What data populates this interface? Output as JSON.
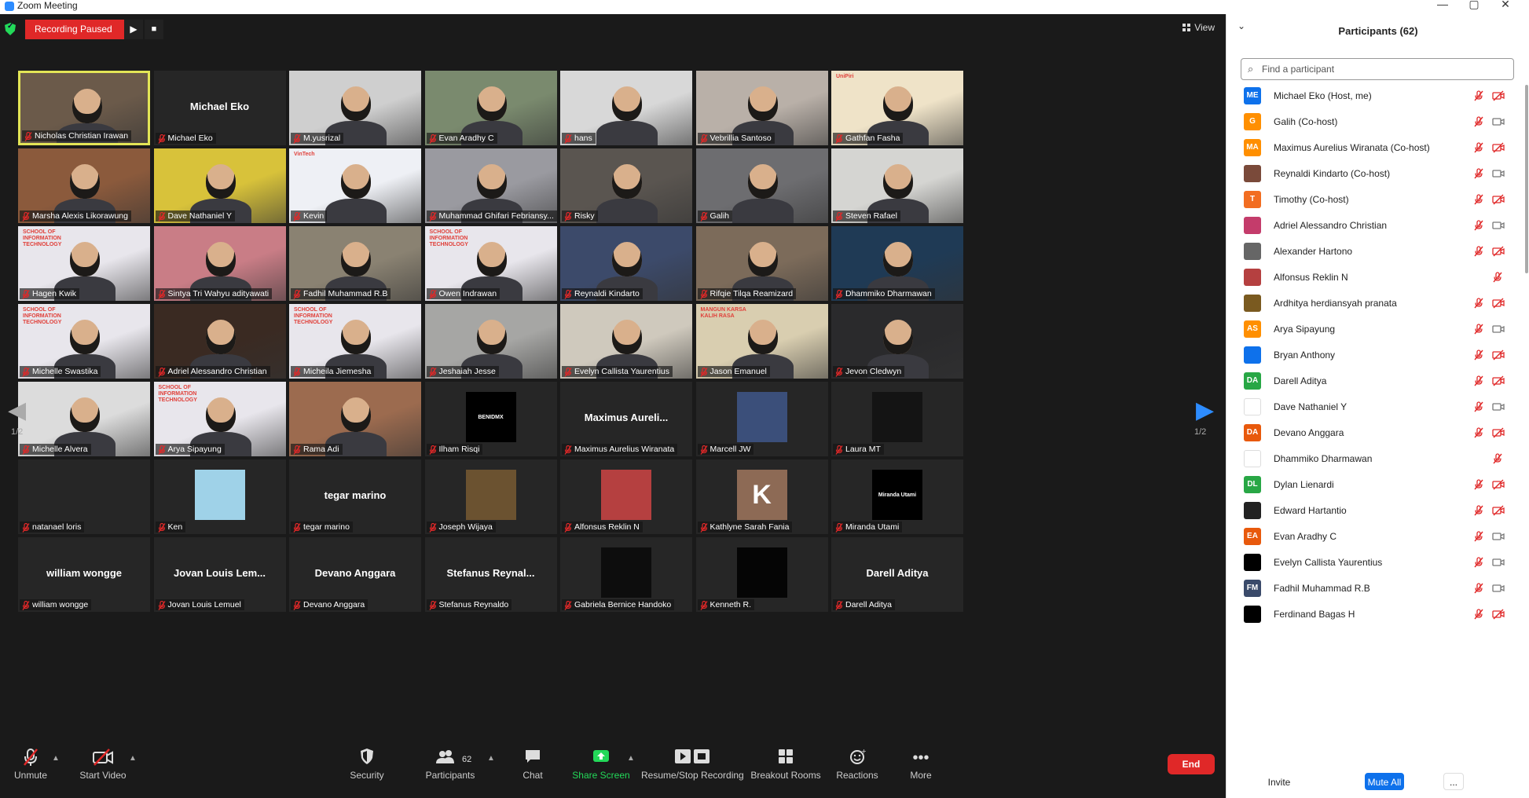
{
  "window": {
    "title": "Zoom Meeting",
    "controls": [
      "—",
      "▢",
      "✕"
    ]
  },
  "topbar": {
    "recording_status": "Recording Paused",
    "play_glyph": "▶",
    "stop_glyph": "■",
    "view_label": "View"
  },
  "colors": {
    "record_red": "#e02828",
    "accent_blue": "#2d8cff",
    "share_green": "#23d959",
    "mute_red": "#e02828",
    "speaker_yellow": "#e3e556"
  },
  "grid": {
    "page_indicator": "1/2",
    "prev_glyph": "◀",
    "next_glyph": "▶",
    "tiles": [
      {
        "label": "Nicholas Christian Irawan",
        "active": true,
        "kind": "video",
        "bg": "#6b5a4a"
      },
      {
        "label": "Michael Eko",
        "kind": "name",
        "big_text": "Michael Eko"
      },
      {
        "label": "M.yusrizal",
        "kind": "video",
        "bg": "#cfcfcf"
      },
      {
        "label": "Evan Aradhy C",
        "kind": "video",
        "bg": "#7a8a6e"
      },
      {
        "label": "hans",
        "kind": "video",
        "bg": "#d8d8d8"
      },
      {
        "label": "Vebrillia Santoso",
        "kind": "video",
        "bg": "#b9b0a8"
      },
      {
        "label": "Gathfan Fasha",
        "kind": "video",
        "bg": "#efe3c8",
        "overlay_text": "UniPiri"
      },
      {
        "label": "Marsha Alexis Likorawung",
        "kind": "video",
        "bg": "#8b5a3c"
      },
      {
        "label": "Dave Nathaniel Y",
        "kind": "video",
        "bg": "#d8c23a"
      },
      {
        "label": "Kevin",
        "kind": "video",
        "bg": "#eef0f5",
        "overlay_text": "VinTech"
      },
      {
        "label": "Muhammad Ghifari Febriansy...",
        "kind": "video",
        "bg": "#9a9aa0"
      },
      {
        "label": "Risky",
        "kind": "video",
        "bg": "#5a5550"
      },
      {
        "label": "Galih",
        "kind": "video",
        "bg": "#6d6d70"
      },
      {
        "label": "Steven Rafael",
        "kind": "video",
        "bg": "#d5d5d2"
      },
      {
        "label": "Hagen Kwik",
        "kind": "video",
        "bg": "#e8e6ec",
        "overlay_text": "SCHOOL OF INFORMATION TECHNOLOGY"
      },
      {
        "label": "Sintya Tri Wahyu adityawati",
        "kind": "video",
        "bg": "#c97d86"
      },
      {
        "label": "Fadhil Muhammad R.B",
        "kind": "video",
        "bg": "#8a8272"
      },
      {
        "label": "Owen Indrawan",
        "kind": "video",
        "bg": "#e8e6ec",
        "overlay_text": "SCHOOL OF INFORMATION TECHNOLOGY"
      },
      {
        "label": "Reynaldi Kindarto",
        "kind": "video",
        "bg": "#3c4a6a"
      },
      {
        "label": "Rifqie Tilqa Reamizard",
        "kind": "video",
        "bg": "#7c6b5a"
      },
      {
        "label": "Dhammiko Dharmawan",
        "kind": "video",
        "bg": "#1f3a55"
      },
      {
        "label": "Michelle Swastika",
        "kind": "video",
        "bg": "#e8e6ec",
        "overlay_text": "SCHOOL OF INFORMATION TECHNOLOGY"
      },
      {
        "label": "Adriel Alessandro Christian",
        "kind": "video",
        "bg": "#3a2a22"
      },
      {
        "label": "Micheila Jiemesha",
        "kind": "video",
        "bg": "#e8e6ec",
        "overlay_text": "SCHOOL OF INFORMATION TECHNOLOGY"
      },
      {
        "label": "Jeshaiah Jesse",
        "kind": "video",
        "bg": "#a6a6a4"
      },
      {
        "label": "Evelyn Callista Yaurentius",
        "kind": "video",
        "bg": "#cfc9bd"
      },
      {
        "label": "Jason Emanuel",
        "kind": "video",
        "bg": "#d9ceb0",
        "overlay_text": "MANGUN KARSA KALIH RASA"
      },
      {
        "label": "Jevon Cledwyn",
        "kind": "video",
        "bg": "#2a2a2c"
      },
      {
        "label": "Michelle Alvera",
        "kind": "video",
        "bg": "#dcdcdc"
      },
      {
        "label": "Arya Sipayung",
        "kind": "video",
        "bg": "#e8e6ec",
        "overlay_text": "SCHOOL OF INFORMATION TECHNOLOGY"
      },
      {
        "label": "Rama Adi",
        "kind": "video",
        "bg": "#9c6b4f"
      },
      {
        "label": "Ilham Risqi",
        "kind": "avatar",
        "avatar_bg": "#000000",
        "avatar_text": "BENIDMX"
      },
      {
        "label": "Maximus Aurelius Wiranata",
        "kind": "name",
        "big_text": "Maximus  Aureli..."
      },
      {
        "label": "Marcell JW",
        "kind": "avatar",
        "avatar_bg": "#3b4f7a",
        "avatar_text": ""
      },
      {
        "label": "Laura MT",
        "kind": "avatar",
        "avatar_bg": "#141414",
        "avatar_text": ""
      },
      {
        "label": "natanael loris",
        "kind": "blank"
      },
      {
        "label": "Ken",
        "kind": "avatar",
        "avatar_bg": "#9fd2e8",
        "avatar_text": ""
      },
      {
        "label": "tegar marino",
        "kind": "name",
        "big_text": "tegar marino"
      },
      {
        "label": "Joseph Wijaya",
        "kind": "avatar",
        "avatar_bg": "#6b5230",
        "avatar_text": ""
      },
      {
        "label": "Alfonsus Reklin N",
        "kind": "avatar",
        "avatar_bg": "#b54040",
        "avatar_text": ""
      },
      {
        "label": "Kathlyne Sarah Fania",
        "kind": "avatar",
        "avatar_bg": "#8d6a55",
        "avatar_text": "K"
      },
      {
        "label": "Miranda Utami",
        "kind": "avatar",
        "avatar_bg": "#000000",
        "avatar_text": "Miranda Utami"
      },
      {
        "label": "william wongge",
        "kind": "name",
        "big_text": "william wongge"
      },
      {
        "label": "Jovan Louis Lemuel",
        "kind": "name",
        "big_text": "Jovan  Louis  Lem..."
      },
      {
        "label": "Devano Anggara",
        "kind": "name",
        "big_text": "Devano Anggara"
      },
      {
        "label": "Stefanus Reynaldo",
        "kind": "name",
        "big_text": "Stefanus  Reynal..."
      },
      {
        "label": "Gabriela Bernice Handoko",
        "kind": "avatar",
        "avatar_bg": "#0d0d0d",
        "avatar_text": ""
      },
      {
        "label": "Kenneth R.",
        "kind": "avatar",
        "avatar_bg": "#050505",
        "avatar_text": ""
      },
      {
        "label": "Darell Aditya",
        "kind": "name",
        "big_text": "Darell Aditya"
      }
    ]
  },
  "toolbar": {
    "unmute": {
      "label": "Unmute",
      "icon": "mic-muted-icon"
    },
    "start_video": {
      "label": "Start Video",
      "icon": "video-off-icon"
    },
    "security": {
      "label": "Security",
      "icon": "shield-icon"
    },
    "participants": {
      "label": "Participants",
      "count": "62",
      "icon": "people-icon"
    },
    "chat": {
      "label": "Chat",
      "icon": "chat-icon"
    },
    "share_screen": {
      "label": "Share Screen",
      "icon": "share-arrow-icon"
    },
    "recording": {
      "label": "Resume/Stop Recording",
      "icon": "record-controls-icon"
    },
    "breakout": {
      "label": "Breakout Rooms",
      "icon": "grid-icon"
    },
    "reactions": {
      "label": "Reactions",
      "icon": "smiley-icon"
    },
    "more": {
      "label": "More",
      "icon": "ellipsis-icon"
    },
    "end": {
      "label": "End"
    }
  },
  "panel": {
    "title": "Participants (62)",
    "search_placeholder": "Find a participant",
    "participants": [
      {
        "name": "Michael Eko (Host, me)",
        "initials": "ME",
        "color": "#0e71eb",
        "cam_off": true
      },
      {
        "name": "Galih (Co-host)",
        "initials": "G",
        "color": "#ff8f00",
        "cam_off": false
      },
      {
        "name": "Maximus Aurelius Wiranata (Co-host)",
        "initials": "MA",
        "color": "#ff8f00",
        "cam_off": true
      },
      {
        "name": "Reynaldi Kindarto (Co-host)",
        "initials": "",
        "color": "#7a4a3a",
        "cam_off": false
      },
      {
        "name": "Timothy (Co-host)",
        "initials": "T",
        "color": "#f26d21",
        "cam_off": true
      },
      {
        "name": "Adriel Alessandro Christian",
        "initials": "",
        "color": "#c43c6b",
        "cam_off": false
      },
      {
        "name": "Alexander Hartono",
        "initials": "",
        "color": "#666666",
        "cam_off": true
      },
      {
        "name": "Alfonsus Reklin N",
        "initials": "",
        "color": "#b54040",
        "cam_off": true,
        "no_mic": true
      },
      {
        "name": "Ardhitya herdiansyah pranata",
        "initials": "",
        "color": "#7a5a20",
        "cam_off": true
      },
      {
        "name": "Arya Sipayung",
        "initials": "AS",
        "color": "#ff8f00",
        "cam_off": false
      },
      {
        "name": "Bryan Anthony",
        "initials": "",
        "color": "#0e71eb",
        "cam_off": true
      },
      {
        "name": "Darell Aditya",
        "initials": "DA",
        "color": "#28a745",
        "cam_off": true
      },
      {
        "name": "Dave Nathaniel Y",
        "initials": "",
        "color": "#ffffff",
        "cam_off": false
      },
      {
        "name": "Devano Anggara",
        "initials": "DA",
        "color": "#e8590c",
        "cam_off": true
      },
      {
        "name": "Dhammiko Dharmawan",
        "initials": "",
        "color": "#ffffff",
        "cam_off": false,
        "no_mic": true
      },
      {
        "name": "Dylan Lienardi",
        "initials": "DL",
        "color": "#28a745",
        "cam_off": true
      },
      {
        "name": "Edward Hartantio",
        "initials": "",
        "color": "#222222",
        "cam_off": true
      },
      {
        "name": "Evan Aradhy C",
        "initials": "EA",
        "color": "#e8590c",
        "cam_off": false
      },
      {
        "name": "Evelyn Callista Yaurentius",
        "initials": "",
        "color": "#000000",
        "cam_off": false
      },
      {
        "name": "Fadhil Muhammad R.B",
        "initials": "FM",
        "color": "#3a4a6a",
        "cam_off": false
      },
      {
        "name": "Ferdinand Bagas H",
        "initials": "",
        "color": "#000000",
        "cam_off": true
      }
    ],
    "footer": {
      "invite": "Invite",
      "mute_all": "Mute All",
      "more": "..."
    }
  }
}
